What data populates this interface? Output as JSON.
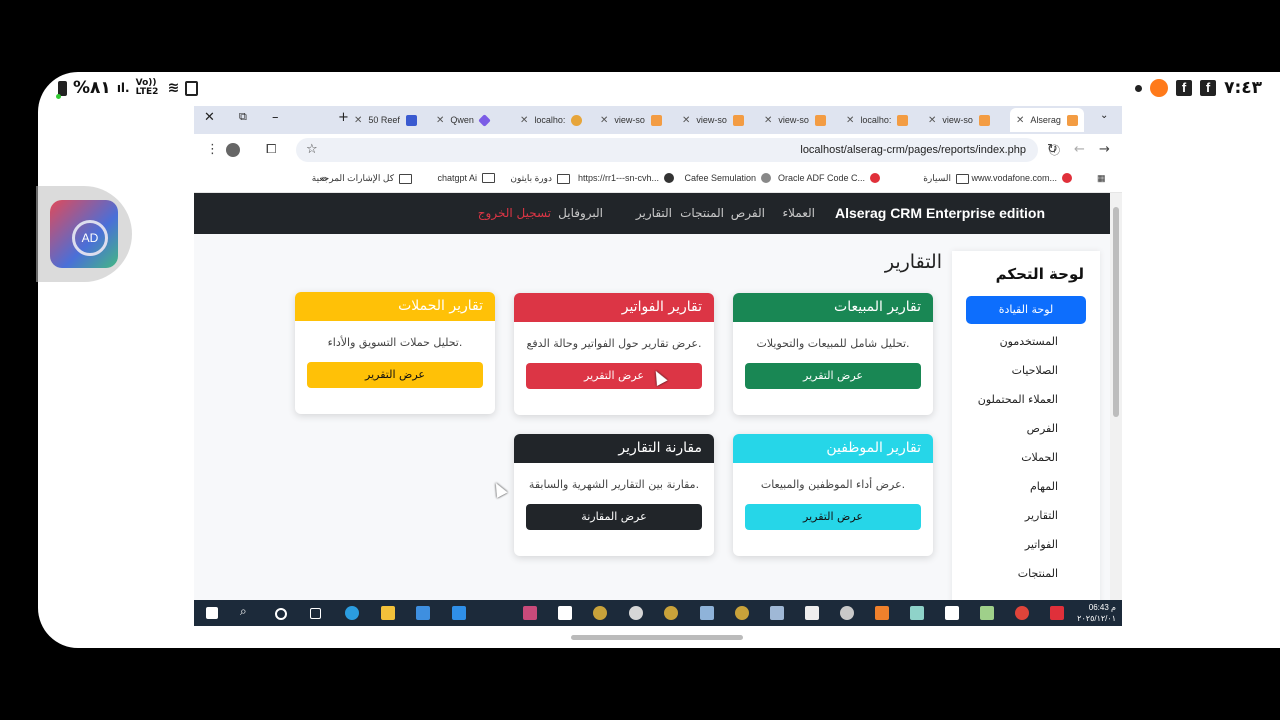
{
  "status_bar": {
    "time": "٧:٤٣",
    "battery": "%٨١",
    "network": "Vo)) LTE2"
  },
  "browser": {
    "tabs": [
      {
        "label": "50 Reef"
      },
      {
        "label": "Qwen"
      },
      {
        "label": "localho:"
      },
      {
        "label": "view-so"
      },
      {
        "label": "view-so"
      },
      {
        "label": "view-so"
      },
      {
        "label": "localho:"
      },
      {
        "label": "view-so"
      },
      {
        "label": "Alserag"
      }
    ],
    "url": "localhost/alserag-crm/pages/reports/index.php",
    "bookmarks": [
      {
        "label": "www.vodafone.com..."
      },
      {
        "label": "السيارة"
      },
      {
        "label": "Oracle ADF Code C..."
      },
      {
        "label": "Cafee Semulation"
      },
      {
        "label": "https://rr1---sn-cvh..."
      },
      {
        "label": "دورة بايثون"
      },
      {
        "label": "chatgpt Ai"
      },
      {
        "label": "كل الإشارات المرجعية"
      }
    ]
  },
  "navbar": {
    "brand": "Alserag CRM Enterprise edition",
    "links": [
      "العملاء",
      "الفرص",
      "المنتجات",
      "التقارير"
    ],
    "profile": "البروفايل",
    "logout": "تسجيل الخروج"
  },
  "sidebar": {
    "title": "لوحة التحكم",
    "active": "لوحة القيادة",
    "items": [
      "المستخدمون",
      "الصلاحيات",
      "العملاء المحتملون",
      "الفرص",
      "الحملات",
      "المهام",
      "التقارير",
      "الفواتير",
      "المنتجات"
    ]
  },
  "page": {
    "title": "التقارير"
  },
  "cards": [
    {
      "title": "تقارير المبيعات",
      "desc": "تحليل شامل للمبيعات والتحويلات.",
      "button": "عرض التقرير",
      "color": "#198754"
    },
    {
      "title": "تقارير الفواتير",
      "desc": "عرض تقارير حول الفواتير وحالة الدفع.",
      "button": "عرض التقرير",
      "color": "#dc3545"
    },
    {
      "title": "تقارير الحملات",
      "desc": "تحليل حملات التسويق والأداء.",
      "button": "عرض التقرير",
      "color": "#ffc107"
    },
    {
      "title": "تقارير الموظفين",
      "desc": "عرض أداء الموظفين والمبيعات.",
      "button": "عرض التقرير",
      "color": "#26d6e8"
    },
    {
      "title": "مقارنة التقارير",
      "desc": "مقارنة بين التقارير الشهرية والسابقة.",
      "button": "عرض المقارنة",
      "color": "#212529"
    }
  ],
  "taskbar": {
    "time": "06:43",
    "ampm": "م",
    "date": "٢٠٢٥/١٢/٠١"
  }
}
